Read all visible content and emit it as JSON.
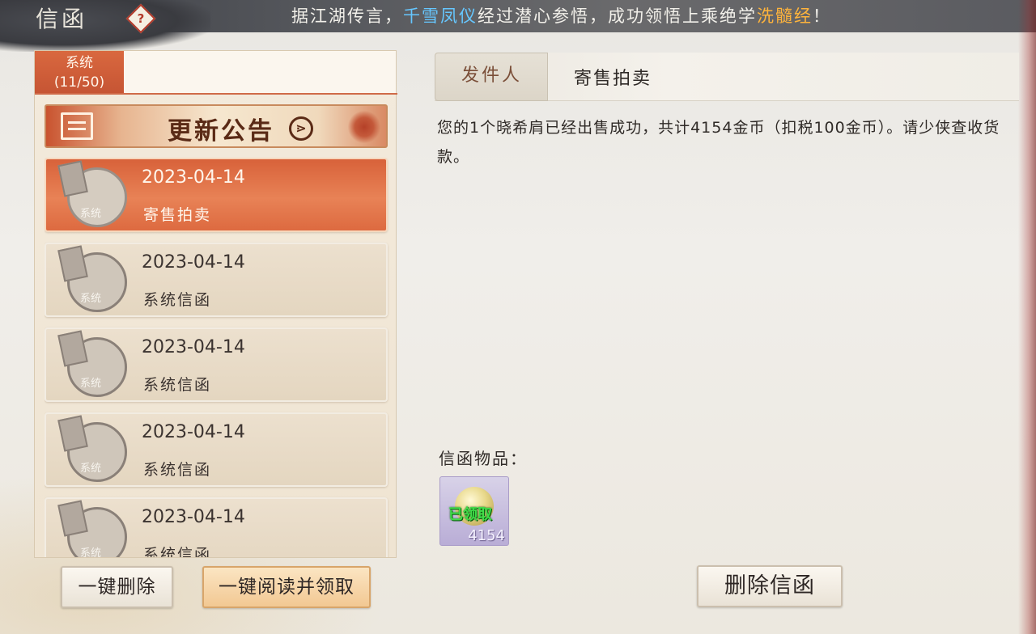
{
  "window": {
    "title": "信函",
    "help_icon": "?"
  },
  "marquee": {
    "prefix": "据江湖传言，",
    "player": "千雪凤仪",
    "middle": "经过潜心参悟，成功领悟上乘绝学",
    "skill": "洗髓经",
    "suffix": "！"
  },
  "sidebar": {
    "category_tab": {
      "label": "系统",
      "count": "(11/50)"
    },
    "announcement": {
      "label": "更新公告",
      "arrow": "⋗"
    },
    "mails": [
      {
        "date": "2023-04-14",
        "subject": "寄售拍卖",
        "stamp": "系统",
        "active": true
      },
      {
        "date": "2023-04-14",
        "subject": "系统信函",
        "stamp": "系统",
        "active": false
      },
      {
        "date": "2023-04-14",
        "subject": "系统信函",
        "stamp": "系统",
        "active": false
      },
      {
        "date": "2023-04-14",
        "subject": "系统信函",
        "stamp": "系统",
        "active": false
      },
      {
        "date": "2023-04-14",
        "subject": "系统信函",
        "stamp": "系统",
        "active": false
      }
    ]
  },
  "detail": {
    "sender_label": "发件人",
    "sender": "寄售拍卖",
    "body": "您的1个晓希肩已经出售成功，共计4154金币（扣税100金币）。请少侠查收货款。",
    "attachments_label": "信函物品：",
    "attachment": {
      "icon": "coin-icon",
      "status": "已领取",
      "count": "4154"
    }
  },
  "actions": {
    "delete_all": "一键删除",
    "read_all_claim": "一键阅读并领取",
    "delete_mail": "删除信函"
  },
  "colors": {
    "active_item": "#d8623a",
    "player_highlight": "#66c7ff",
    "skill_highlight": "#ffb43c",
    "claimed_text": "#3fdc48"
  }
}
